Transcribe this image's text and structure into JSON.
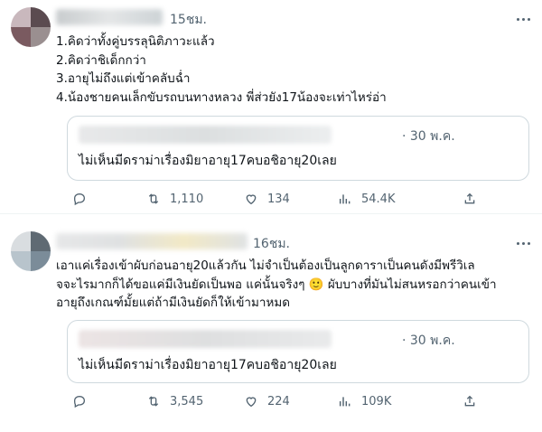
{
  "tweets": [
    {
      "time": "15ชม.",
      "lines": [
        "1.คิดว่าทั้งคู่บรรลุนิติภาวะแล้ว",
        "2.คิดว่าชิเด็กกว่า",
        "3.อายุไม่ถึงแต่เข้าคลับฉ่ำ",
        "4.น้องชายคนเล็กขับรถบนทางหลวง พี่ส่วยัง17น้องจะเท่าไหร่อ่า"
      ],
      "quote": {
        "time": "· 30 พ.ค.",
        "text": "ไม่เห็นมีดราม่าเรื่องมิยาอายุ17คบอชิอายุ20เลย"
      },
      "stats": {
        "retweets": "1,110",
        "likes": "134",
        "views": "54.4K"
      }
    },
    {
      "time": "16ชม.",
      "lines": [
        "เอาแค่เรื่องเข้าผับก่อนอายุ20แล้วกัน ไม่จำเป็นต้องเป็นลูกดาราเป็นคนดังมีพรีวิเล",
        "จจะไรมากก็ได้ขอแค่มีเงินยัดเป็นพอ แค่นั้นจริงๆ 🙂 ผับบางที่มันไม่สนหรอกว่าคนเข้า",
        "อายุถึงเกณฑ์มั้ยแต่ถ้ามีเงินยัดก็ให้เข้ามาหมด"
      ],
      "quote": {
        "time": "· 30 พ.ค.",
        "text": "ไม่เห็นมีดราม่าเรื่องมิยาอายุ17คบอชิอายุ20เลย"
      },
      "stats": {
        "retweets": "3,545",
        "likes": "224",
        "views": "109K"
      }
    }
  ],
  "colors": {
    "text": "#0f1419",
    "muted": "#536471",
    "border": "#cfd9de",
    "emoji": "#f7c948"
  },
  "icons": [
    "reply-icon",
    "retweet-icon",
    "like-icon",
    "views-icon",
    "share-icon",
    "more-icon"
  ]
}
